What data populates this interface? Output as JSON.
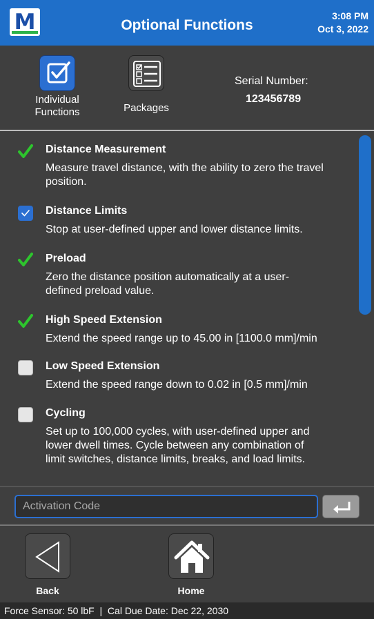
{
  "header": {
    "logo_letter": "M",
    "title": "Optional Functions",
    "time": "3:08 PM",
    "date": "Oct 3, 2022"
  },
  "tabs": [
    {
      "line1": "Individual",
      "line2": "Functions",
      "icon": "checkbox-icon",
      "active": true
    },
    {
      "line1": "Packages",
      "icon": "checklist-icon",
      "active": false
    }
  ],
  "serial": {
    "label": "Serial Number:",
    "value": "123456789"
  },
  "functions": [
    {
      "title": "Distance Measurement",
      "desc1": "Measure travel distance, with the ability to zero the travel",
      "desc2": "position.",
      "state": "installed"
    },
    {
      "title": "Distance Limits",
      "desc1": "Stop at user-defined upper and lower distance limits.",
      "state": "selected"
    },
    {
      "title": "Preload",
      "desc1": "Zero the distance position automatically at a user-",
      "desc2": "defined preload value.",
      "state": "installed"
    },
    {
      "title": "High Speed Extension",
      "desc1": "Extend the speed range up to 45.00 in [1100.0 mm]/min",
      "state": "installed"
    },
    {
      "title": "Low Speed Extension",
      "desc1": "Extend the speed range down to 0.02 in [0.5 mm]/min",
      "state": "unselected"
    },
    {
      "title": "Cycling",
      "desc1": "Set up to 100,000 cycles, with user-defined upper and",
      "desc2": "lower dwell times. Cycle between any combination of",
      "desc3": "limit switches, distance limits, breaks, and load limits.",
      "state": "unselected"
    }
  ],
  "activation": {
    "placeholder": "Activation Code",
    "value": ""
  },
  "nav": {
    "back_label": "Back",
    "home_label": "Home"
  },
  "status_bar": {
    "text": "Force Sensor: 50 lbF  |  Cal Due Date: Dec 22, 2030"
  },
  "colors": {
    "header_blue": "#1f6fc9",
    "check_green": "#2dc52d",
    "checkbox_blue": "#2b6fd1",
    "background": "#3f3f3f"
  }
}
